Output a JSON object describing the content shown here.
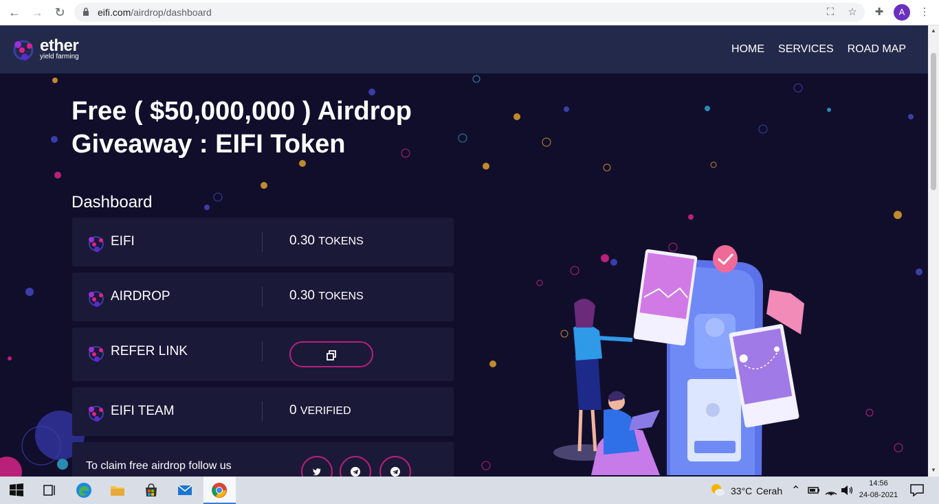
{
  "browser": {
    "url_domain": "eifi.com",
    "url_path": "/airdrop/dashboard"
  },
  "site": {
    "logo_word": "ether",
    "logo_sub": "yield farming",
    "nav": [
      "HOME",
      "SERVICES",
      "ROAD MAP"
    ]
  },
  "hero": {
    "title_line1": "Free ( $50,000,000 ) Airdrop",
    "title_line2": "Giveaway : EIFI Token"
  },
  "dashboard": {
    "title": "Dashboard",
    "rows": [
      {
        "label": "EIFI",
        "value": "0.30",
        "unit": "TOKENS"
      },
      {
        "label": "AIRDROP",
        "value": "0.30",
        "unit": "TOKENS"
      },
      {
        "label": "REFER LINK",
        "button_icon": "copy-icon"
      },
      {
        "label": "EIFI TEAM",
        "value": "0",
        "unit": "VERIFIED"
      }
    ],
    "claim_text": "To claim free airdrop follow us",
    "social_icons": [
      "twitter-icon",
      "telegram-icon",
      "telegram-icon"
    ]
  },
  "taskbar": {
    "weather": "33°C",
    "weather_desc": "Cerah",
    "time": "14:56",
    "date": "24-08-2021"
  },
  "colors": {
    "page_bg": "#110e2c",
    "nav_bg": "#23294a",
    "card_bg": "#1b1938",
    "accent": "#b8207a"
  }
}
